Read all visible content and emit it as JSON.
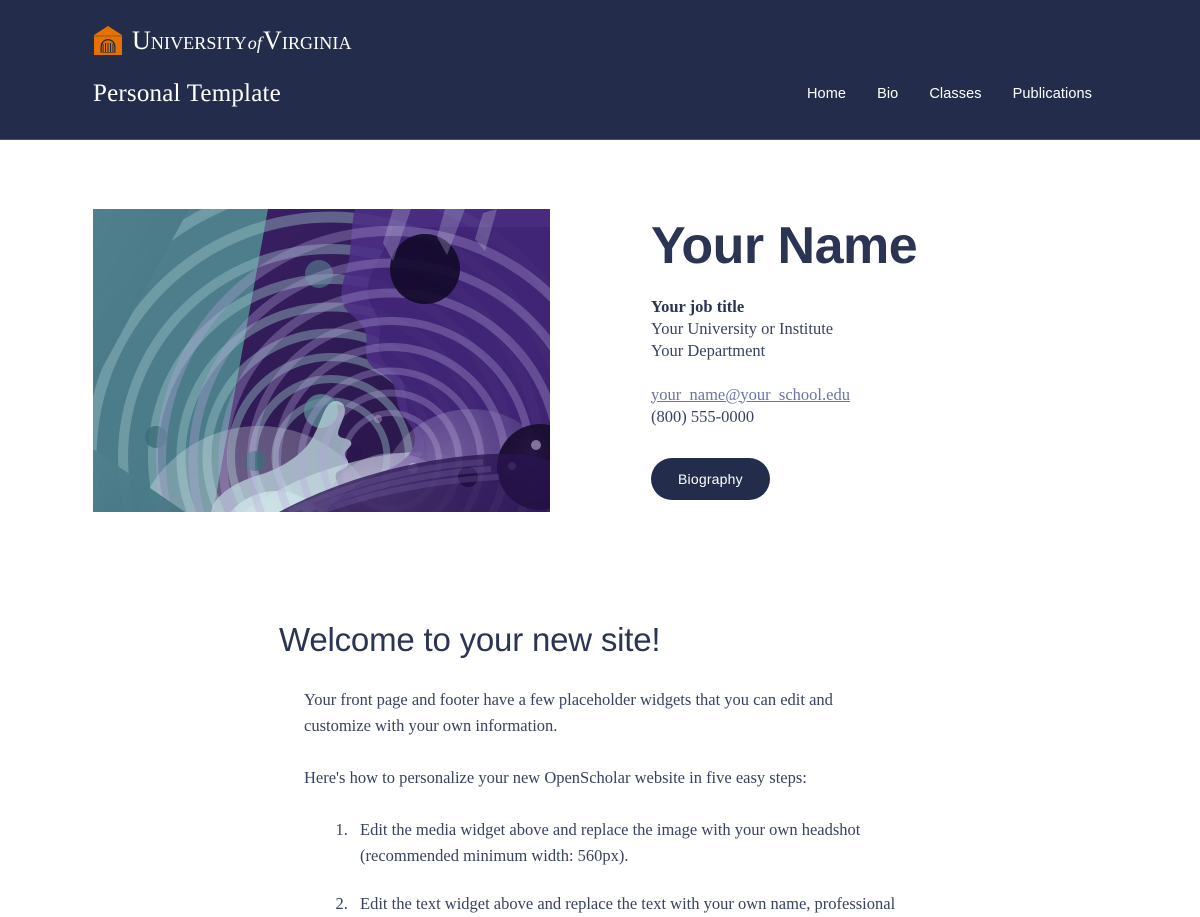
{
  "header": {
    "brand": {
      "icon": "uva-rotunda-icon",
      "word_university": "University",
      "word_of": "of",
      "word_virginia": "Virginia",
      "full_text": "University of Virginia"
    },
    "site_title": "Personal Template",
    "nav": [
      {
        "label": "Home"
      },
      {
        "label": "Bio"
      },
      {
        "label": "Classes"
      },
      {
        "label": "Publications"
      }
    ],
    "background_color": "#232D4B",
    "accent_color": "#E57200"
  },
  "hero": {
    "media": {
      "alt": "abstract illustration of two overlapping human profiles with concentric rings",
      "teal_color": "#4a7d8a",
      "purple_color": "#2e1a52"
    },
    "name": "Your Name",
    "job_title": "Your job title",
    "institute": "Your University or Institute",
    "department": "Your Department",
    "email": "your_name@your_school.edu",
    "phone": "(800) 555-0000",
    "button_label": "Biography",
    "link_color": "#6b74a8"
  },
  "welcome": {
    "heading": "Welcome to your new site!",
    "paragraphs": [
      "Your front page and footer have a few placeholder widgets that you can edit and customize with your own information.",
      "Here's how to personalize your new OpenScholar website in five easy steps:"
    ],
    "steps": [
      "Edit the media widget above and replace the image with your own headshot (recommended minimum width: 560px).",
      "Edit the text widget above and replace the text with your own name, professional"
    ]
  }
}
